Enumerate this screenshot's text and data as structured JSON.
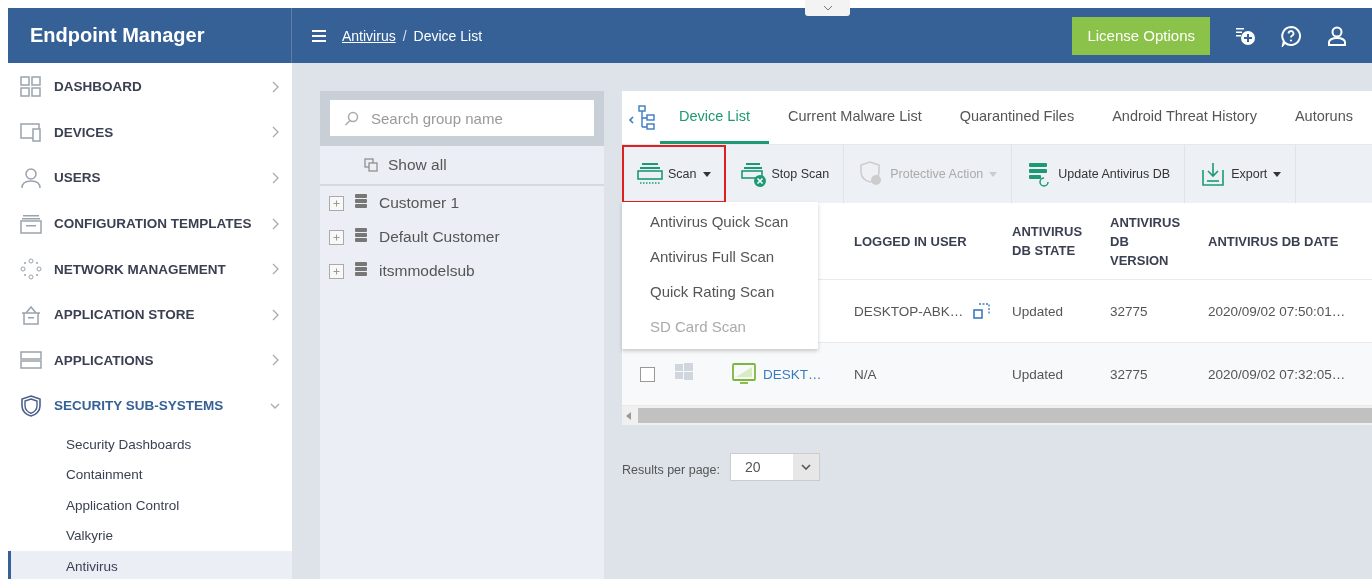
{
  "app": {
    "title": "Endpoint Manager"
  },
  "breadcrumb": [
    {
      "label": "Antivirus",
      "link": true
    },
    {
      "label": "/",
      "link": false
    },
    {
      "label": "Device List",
      "link": false
    }
  ],
  "header_button": "License Options",
  "sidebar": {
    "items": [
      {
        "label": "DASHBOARD",
        "expanded": false
      },
      {
        "label": "DEVICES",
        "expanded": false
      },
      {
        "label": "USERS",
        "expanded": false
      },
      {
        "label": "CONFIGURATION TEMPLATES",
        "expanded": false
      },
      {
        "label": "NETWORK MANAGEMENT",
        "expanded": false
      },
      {
        "label": "APPLICATION STORE",
        "expanded": false
      },
      {
        "label": "APPLICATIONS",
        "expanded": false
      },
      {
        "label": "SECURITY SUB-SYSTEMS",
        "expanded": true,
        "children": [
          {
            "label": "Security Dashboards",
            "selected": false
          },
          {
            "label": "Containment",
            "selected": false
          },
          {
            "label": "Application Control",
            "selected": false
          },
          {
            "label": "Valkyrie",
            "selected": false
          },
          {
            "label": "Antivirus",
            "selected": true
          }
        ]
      }
    ]
  },
  "groups": {
    "search": {
      "placeholder": "Search group name"
    },
    "show_all": "Show all",
    "items": [
      {
        "label": "Customer 1"
      },
      {
        "label": "Default Customer"
      },
      {
        "label": "itsmmodelsub"
      }
    ]
  },
  "tabs": [
    {
      "label": "Device List",
      "selected": true
    },
    {
      "label": "Current Malware List",
      "selected": false
    },
    {
      "label": "Quarantined Files",
      "selected": false
    },
    {
      "label": "Android Threat History",
      "selected": false
    },
    {
      "label": "Autoruns",
      "selected": false
    }
  ],
  "toolbar": [
    {
      "label": "Scan",
      "dropdown": true,
      "disabled": false,
      "highlighted": true
    },
    {
      "label": "Stop Scan",
      "dropdown": false,
      "disabled": false,
      "highlighted": false
    },
    {
      "label": "Protective Action",
      "dropdown": true,
      "disabled": true,
      "highlighted": false
    },
    {
      "label": "Update Antivirus DB",
      "dropdown": false,
      "disabled": false,
      "highlighted": false
    },
    {
      "label": "Export",
      "dropdown": true,
      "disabled": false,
      "highlighted": false
    }
  ],
  "scan_menu": [
    {
      "label": "Antivirus Quick Scan",
      "disabled": false
    },
    {
      "label": "Antivirus Full Scan",
      "disabled": false
    },
    {
      "label": "Quick Rating Scan",
      "disabled": false
    },
    {
      "label": "SD Card Scan",
      "disabled": true
    }
  ],
  "table": {
    "columns": [
      "LOGGED IN USER",
      "ANTIVIRUS DB STATE",
      "ANTIVIRUS DB VERSION",
      "ANTIVIRUS DB DATE"
    ],
    "rows": [
      {
        "logged_in_user": "DESKTOP-ABK…",
        "remote": true,
        "db_state": "Updated",
        "db_version": "32775",
        "db_date": "2020/09/02 07:50:01…"
      },
      {
        "checked": false,
        "name": "DESKT…",
        "logged_in_user": "N/A",
        "db_state": "Updated",
        "db_version": "32775",
        "db_date": "2020/09/02 07:32:05…"
      }
    ]
  },
  "pagination": {
    "label": "Results per page:",
    "value": "20"
  }
}
